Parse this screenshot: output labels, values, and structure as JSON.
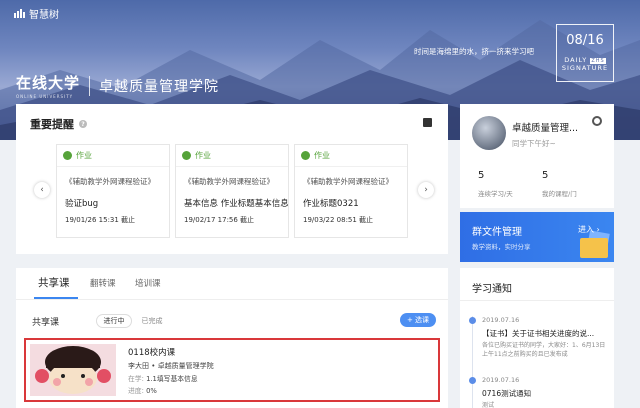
{
  "banner": {
    "logo_text": "智慧树",
    "brand_main": "在线大学",
    "brand_sub": "ONLINE UNIVERSITY",
    "school": "卓越质量管理学院",
    "motto": "时间是海绵里的水，挤一挤来学习吧",
    "date": "08/16",
    "date_line1": "DAILY",
    "date_tag": "ZHS",
    "date_line2": "SIGNATURE"
  },
  "reminder": {
    "title": "重要提醒",
    "prev_icon": "‹",
    "next_icon": "›",
    "tasks": [
      {
        "type": "作业",
        "course": "《辅助教学外网课程验证》",
        "name": "验证bug",
        "time": "19/01/26 15:31 截止"
      },
      {
        "type": "作业",
        "course": "《辅助教学外网课程验证》",
        "name": "基本信息 作业标题基本信息",
        "time": "19/02/17 17:56 截止"
      },
      {
        "type": "作业",
        "course": "《辅助教学外网课程验证》",
        "name": "作业标题0321",
        "time": "19/03/22 08:51 截止"
      }
    ]
  },
  "profile": {
    "name": "卓越质量管理...",
    "greeting": "同学下午好~",
    "stat1_value": "5",
    "stat1_label": "连续学习/天",
    "stat2_value": "5",
    "stat2_label": "我的课程/门"
  },
  "group_files": {
    "title": "群文件管理",
    "subtitle": "教学资料，实时分享",
    "enter": "进入 ›"
  },
  "courses": {
    "tabs": [
      "共享课",
      "翻转课",
      "培训课"
    ],
    "section_label": "共享课",
    "filter_active": "进行中",
    "filter_done": "已完成",
    "add_button": "+ 选课",
    "item": {
      "name": "0118校内课",
      "teacher": "李大田 • 卓越质量管理学院",
      "learning_label": "在学:",
      "learning_value": "1.1填写基本信息",
      "progress_label": "进度:",
      "progress_value": "0%"
    }
  },
  "notice": {
    "title": "学习通知",
    "items": [
      {
        "date": "2019.07.16",
        "title": "【证书】关于证书相关进度的说...",
        "body": "各位已购买证书的同学，大家好：1、6月13日上午11点之前购买的且已发布成"
      },
      {
        "date": "2019.07.16",
        "title": "0716测试通知",
        "body": "测试"
      }
    ]
  },
  "colors": {
    "accent": "#3b86f0",
    "task_green": "#56a33a",
    "highlight_border": "#d9383a"
  }
}
